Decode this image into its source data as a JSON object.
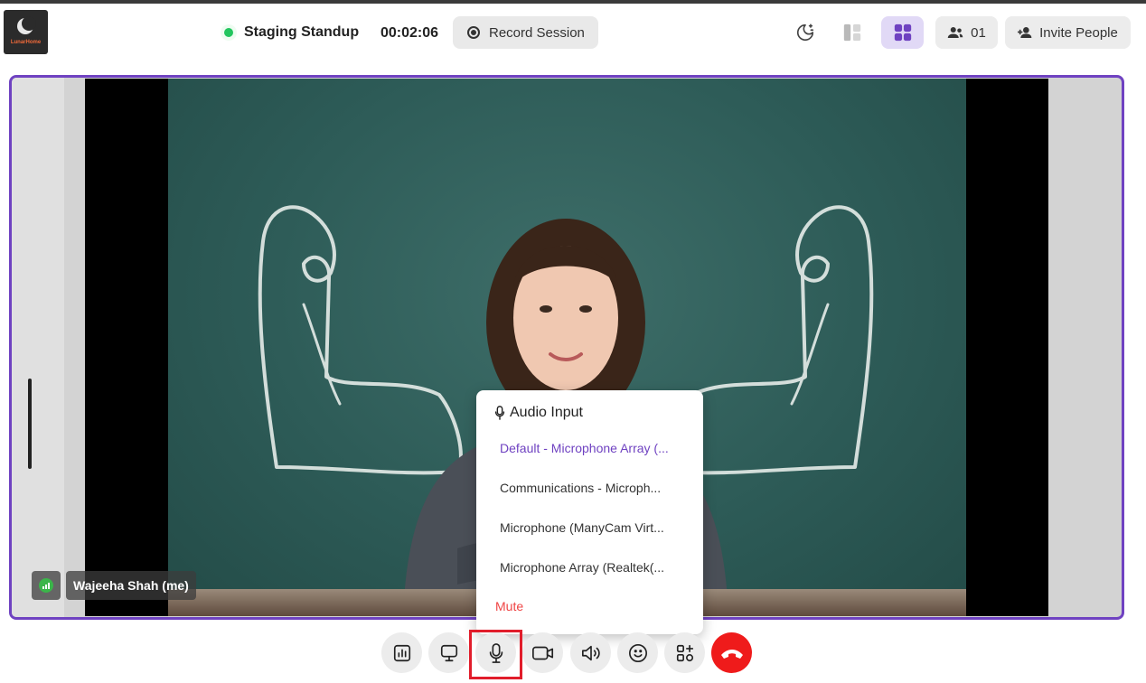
{
  "header": {
    "logo_text": "LunarHome",
    "meeting_title": "Staging Standup",
    "timer": "00:02:06",
    "record_label": "Record Session",
    "participants_count": "01",
    "invite_label": "Invite People",
    "status_color": "#22c55e",
    "accent_color": "#6f42c1"
  },
  "video": {
    "participant_name": "Wajeeha Shah (me)"
  },
  "audio_popup": {
    "title": "Audio Input",
    "options": [
      "Default - Microphone Array (...",
      "Communications - Microph...",
      "Microphone (ManyCam Virt...",
      "Microphone Array (Realtek(..."
    ],
    "selected_option_index": 0,
    "mute_label": "Mute"
  },
  "toolbar": {
    "icons": [
      "stats-icon",
      "screen-share-icon",
      "microphone-icon",
      "camera-icon",
      "speaker-icon",
      "emoji-icon",
      "apps-icon",
      "hang-up-icon"
    ],
    "hang_up_color": "#ef1b1b",
    "highlight_color": "#e11d2b"
  }
}
